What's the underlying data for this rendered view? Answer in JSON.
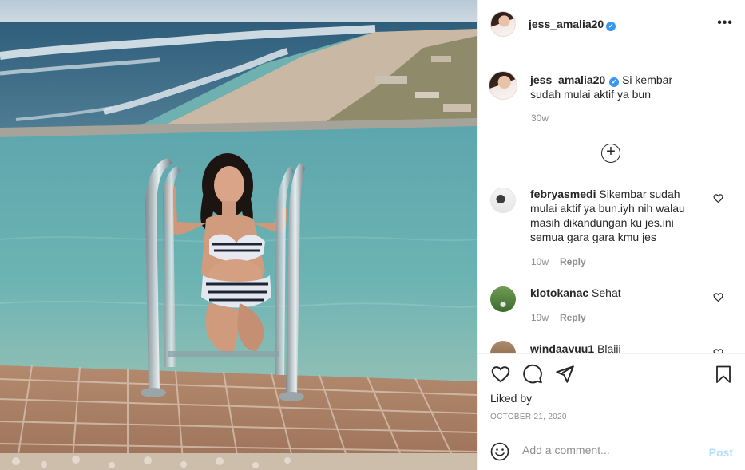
{
  "post": {
    "author": "jess_amalia20",
    "verified_mark": "✓",
    "more_icon": "more-horizontal-icon",
    "caption": "Si kembar sudah mulai aktif ya bun",
    "caption_age": "30w",
    "load_more_icon": "plus-circle-icon"
  },
  "comments": [
    {
      "user": "febryasmedi",
      "text": "Sikembar sudah mulai aktif ya bun.iyh nih walau masih dikandungan ku jes.ini semua gara gara kmu jes",
      "age": "10w",
      "reply_label": "Reply"
    },
    {
      "user": "klotokanac",
      "text": "Sehat",
      "age": "19w",
      "reply_label": "Reply"
    },
    {
      "user": "windaayuu1",
      "text": "Blaiii"
    }
  ],
  "actions": {
    "like_icon": "heart-icon",
    "comment_icon": "comment-icon",
    "share_icon": "send-icon",
    "save_icon": "bookmark-icon",
    "liked_by": "Liked by",
    "date": "OCTOBER 21, 2020"
  },
  "composer": {
    "emoji_icon": "emoji-icon",
    "placeholder": "Add a comment...",
    "post_label": "Post"
  },
  "colors": {
    "link_blue": "#3897f0",
    "post_disabled": "#b2dffc",
    "muted_text": "#8e8e8e"
  }
}
